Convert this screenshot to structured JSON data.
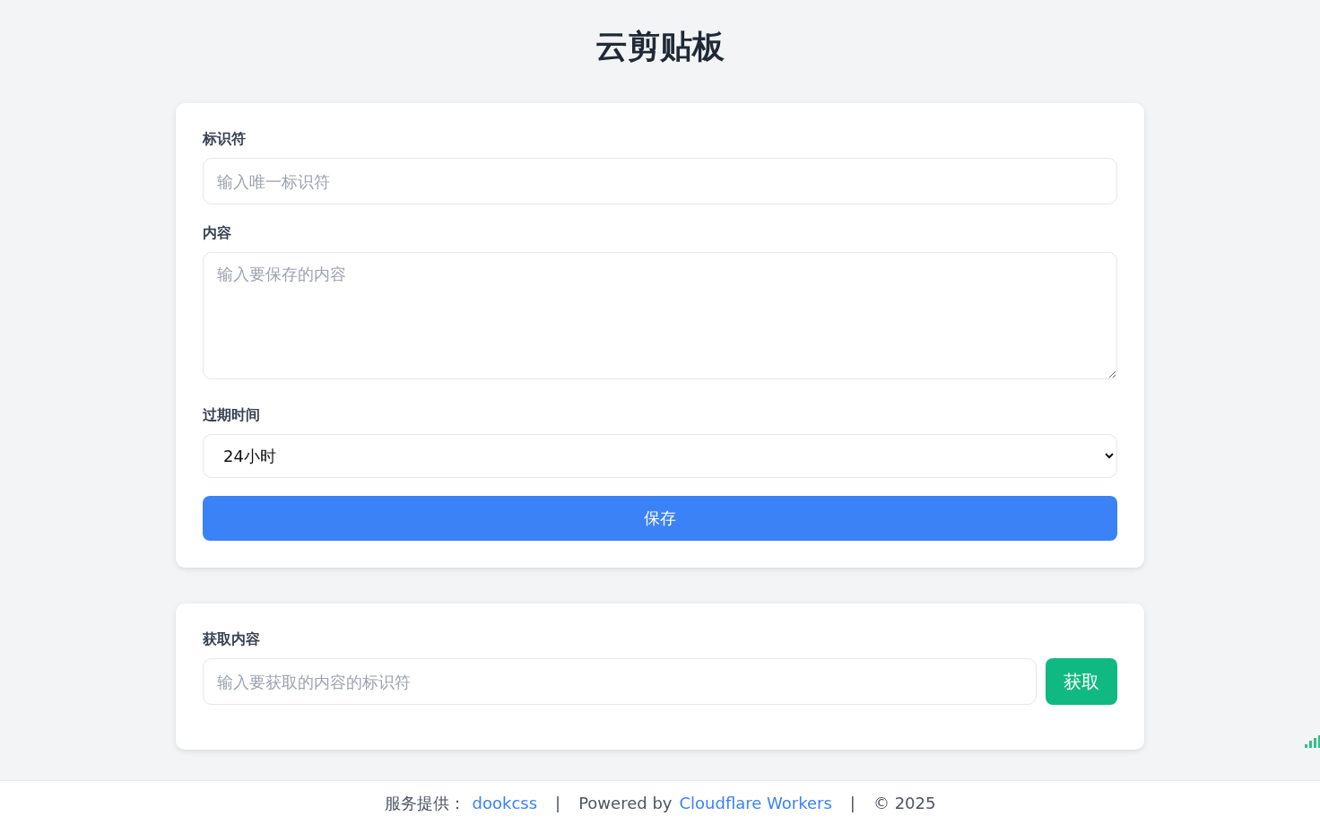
{
  "title": "云剪贴板",
  "save_form": {
    "identifier": {
      "label": "标识符",
      "placeholder": "输入唯一标识符"
    },
    "content": {
      "label": "内容",
      "placeholder": "输入要保存的内容"
    },
    "expiry": {
      "label": "过期时间",
      "value": "24小时"
    },
    "save_button": "保存"
  },
  "fetch_form": {
    "label": "获取内容",
    "placeholder": "输入要获取的内容的标识符",
    "fetch_button": "获取"
  },
  "footer": [
    {
      "kind": "text",
      "text": "服务提供："
    },
    {
      "kind": "link",
      "text": "dookcss"
    },
    {
      "kind": "separator",
      "text": "|"
    },
    {
      "kind": "text",
      "text": "Powered by"
    },
    {
      "kind": "link",
      "text": "Cloudflare Workers"
    },
    {
      "kind": "separator",
      "text": "|"
    },
    {
      "kind": "text",
      "text": "© 2025"
    }
  ]
}
